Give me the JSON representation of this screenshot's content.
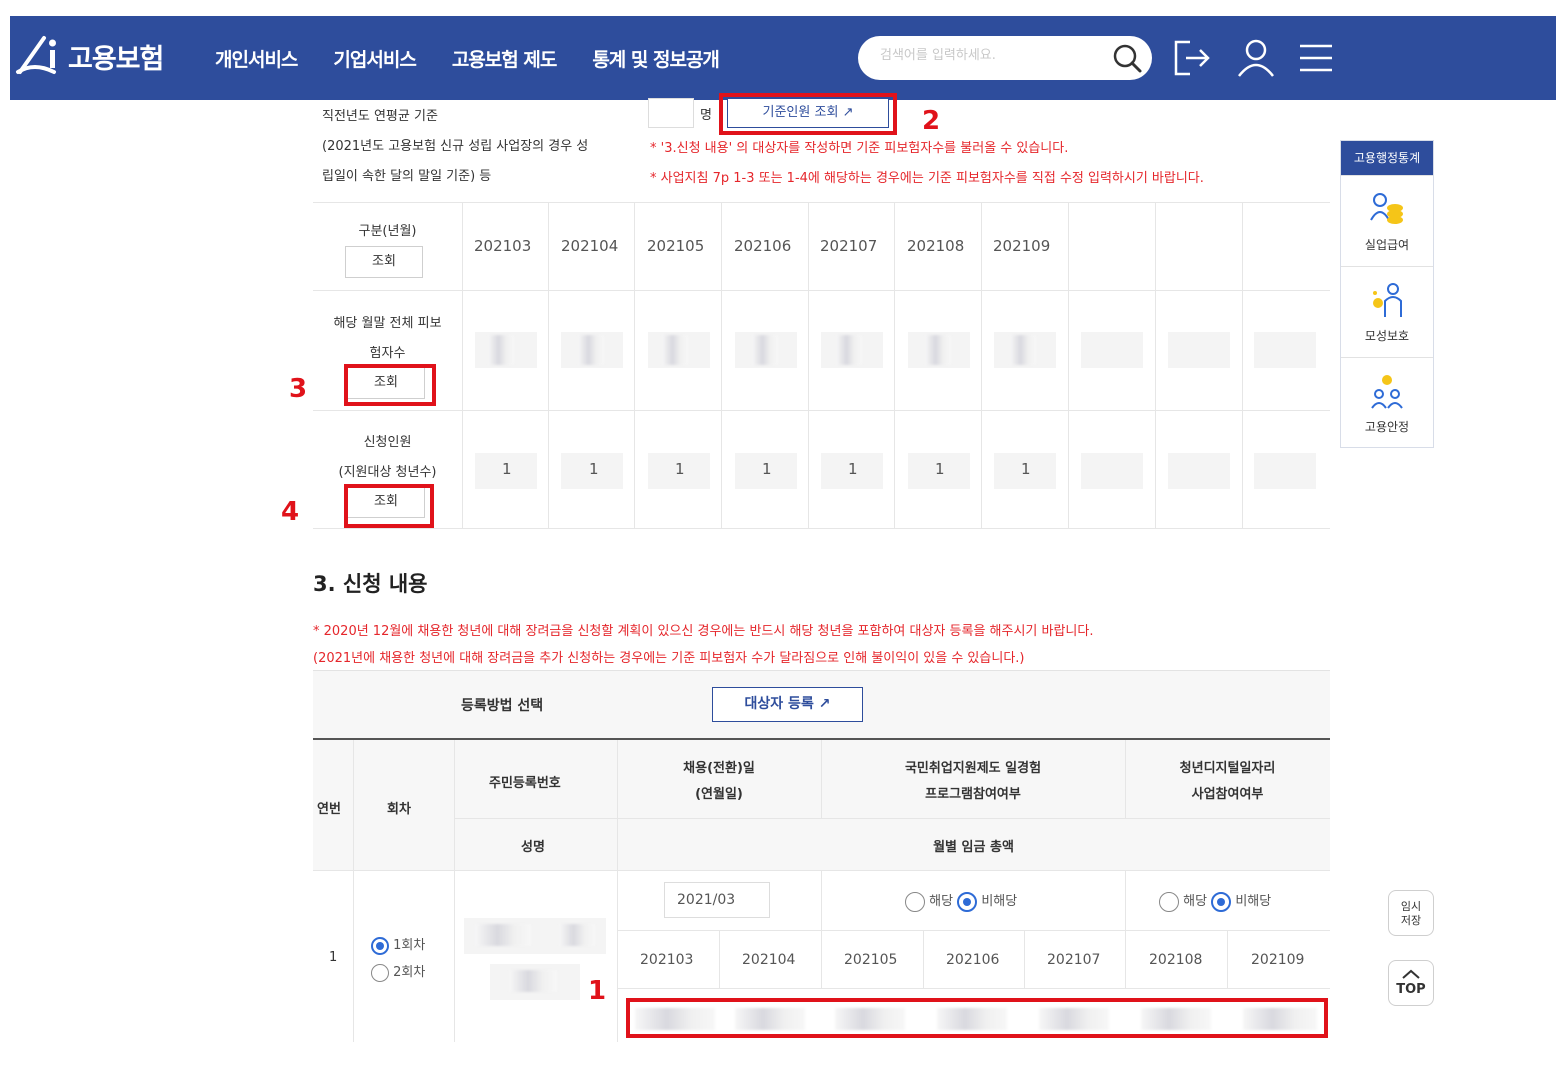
{
  "header": {
    "logo_text": "고용보험",
    "nav": [
      "개인서비스",
      "기업서비스",
      "고용보험 제도",
      "통계 및 정보공개"
    ],
    "search_placeholder": "검색어를 입력하세요."
  },
  "section2": {
    "base_label_lines": [
      "직전년도 연평균 기준",
      "(2021년도 고용보험 신규 성립 사업장의 경우 성",
      "립일이 속한 달의 말일 기준) 등"
    ],
    "unit": "명",
    "base_lookup_button": "기준인원 조회",
    "notes": [
      "* '3.신청 내용' 의 대상자를 작성하면 기준 피보험자수를 불러올 수 있습니다.",
      "* 사업지침 7p 1-3 또는 1-4에 해당하는 경우에는 기준 피보험자수를 직접 수정 입력하시기 바랍니다."
    ],
    "row_headers": {
      "period": "구분(년월)",
      "insured_line1": "해당 월말 전체 피보",
      "insured_line2": "험자수",
      "applicants_line1": "신청인원",
      "applicants_line2": "(지원대상 청년수)",
      "lookup": "조회"
    },
    "months": [
      "202103",
      "202104",
      "202105",
      "202106",
      "202107",
      "202108",
      "202109"
    ],
    "applicant_counts": [
      "1",
      "1",
      "1",
      "1",
      "1",
      "1",
      "1"
    ]
  },
  "annotations": {
    "a1": "1",
    "a2": "2",
    "a3": "3",
    "a4": "4"
  },
  "sidebar": {
    "title": "고용행정통계",
    "items": [
      "실업급여",
      "모성보호",
      "고용안정"
    ]
  },
  "float": {
    "temp_save": "임시저장",
    "top": "TOP"
  },
  "section3": {
    "title": "3. 신청 내용",
    "notes": [
      "* 2020년 12월에 채용한 청년에 대해 장려금을 신청할 계획이 있으신 경우에는 반드시 해당 청년을 포함하여 대상자 등록을 해주시기 바랍니다.",
      "(2021년에 채용한 청년에 대해 장려금을 추가 신청하는 경우에는 기준 피보험자 수가 달라짐으로 인해 불이익이 있을 수 있습니다.)"
    ],
    "register_method_label": "등록방법 선택",
    "register_button": "대상자 등록",
    "table": {
      "col_no": "연번",
      "col_round": "회차",
      "col_rrn": "주민등록번호",
      "col_name": "성명",
      "col_hire_line1": "채용(전환)일",
      "col_hire_line2": "(연월일)",
      "col_gov_line1": "국민취업지원제도 일경험",
      "col_gov_line2": "프로그램참여여부",
      "col_digital_line1": "청년디지털일자리",
      "col_digital_line2": "사업참여여부",
      "col_wage": "월별 임금 총액",
      "row_no": "1",
      "round_opts": [
        "1회차",
        "2회차"
      ],
      "hire_date": "2021/03",
      "yes": "해당",
      "no": "비해당",
      "months": [
        "202103",
        "202104",
        "202105",
        "202106",
        "202107",
        "202108",
        "202109"
      ]
    }
  }
}
